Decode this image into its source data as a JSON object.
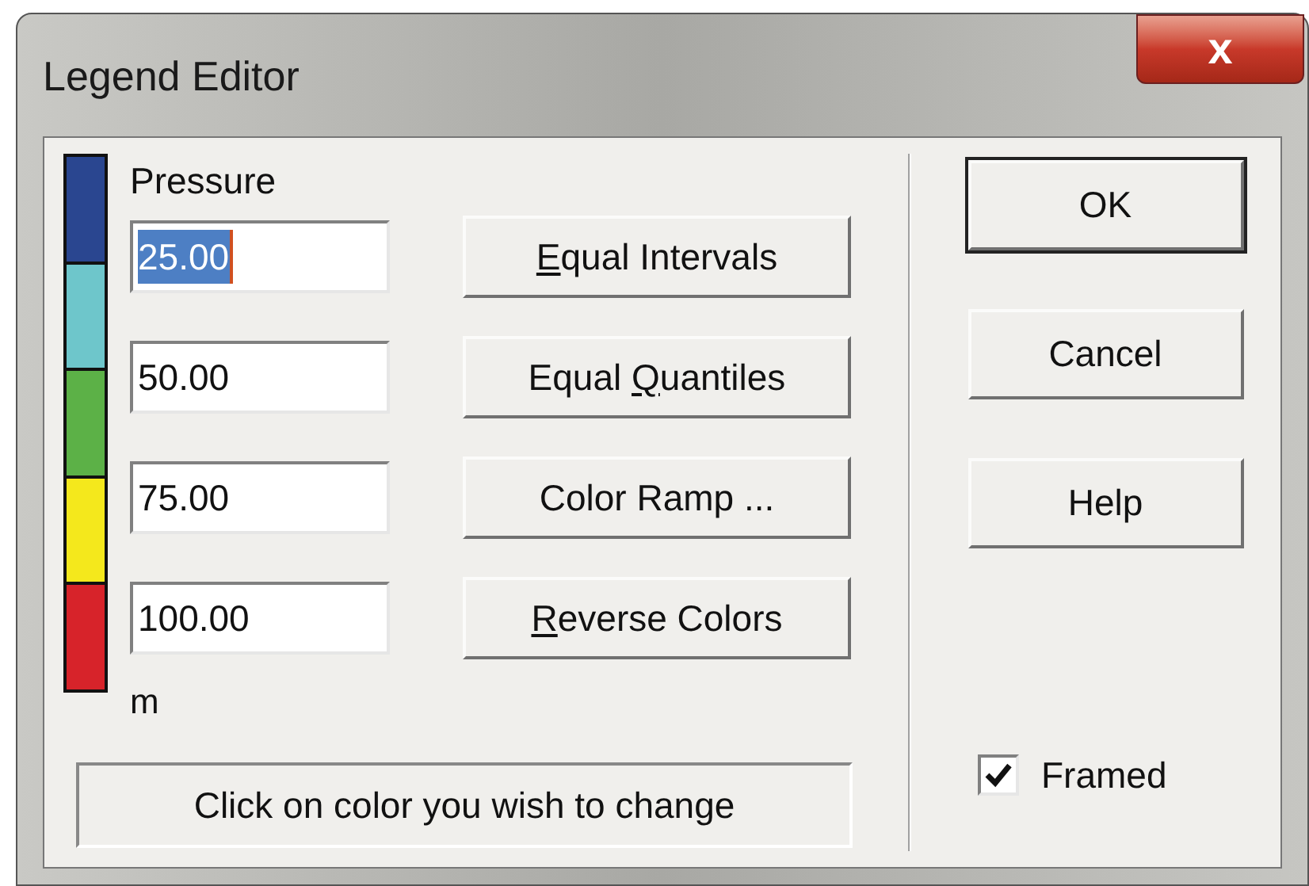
{
  "window": {
    "title": "Legend Editor",
    "close": "x"
  },
  "legend": {
    "title": "Pressure",
    "units": "m",
    "swatches": [
      {
        "color": "#2a4690"
      },
      {
        "color": "#6ec6cb"
      },
      {
        "color": "#5cb147"
      },
      {
        "color": "#f4e81c"
      },
      {
        "color": "#d7232a"
      }
    ]
  },
  "fields": [
    {
      "value": "25.00",
      "selected": true
    },
    {
      "value": "50.00",
      "selected": false
    },
    {
      "value": "75.00",
      "selected": false
    },
    {
      "value": "100.00",
      "selected": false
    }
  ],
  "buttons": [
    {
      "label_parts": [
        {
          "text": "E",
          "underlined": true
        },
        {
          "text": "qual Intervals",
          "underlined": false
        }
      ]
    },
    {
      "label_parts": [
        {
          "text": "Equal ",
          "underlined": false
        },
        {
          "text": "Q",
          "underlined": true
        },
        {
          "text": "uantiles",
          "underlined": false
        }
      ]
    },
    {
      "label_parts": [
        {
          "text": "Color Ramp ...",
          "underlined": false
        }
      ]
    },
    {
      "label_parts": [
        {
          "text": "R",
          "underlined": true
        },
        {
          "text": "everse Colors",
          "underlined": false
        }
      ]
    }
  ],
  "hint": "Click on color you wish to change",
  "dialog_buttons": [
    {
      "label": "OK",
      "default": true
    },
    {
      "label": "Cancel",
      "default": false
    },
    {
      "label": "Help",
      "default": false
    }
  ],
  "framed": {
    "label": "Framed",
    "checked": true
  }
}
